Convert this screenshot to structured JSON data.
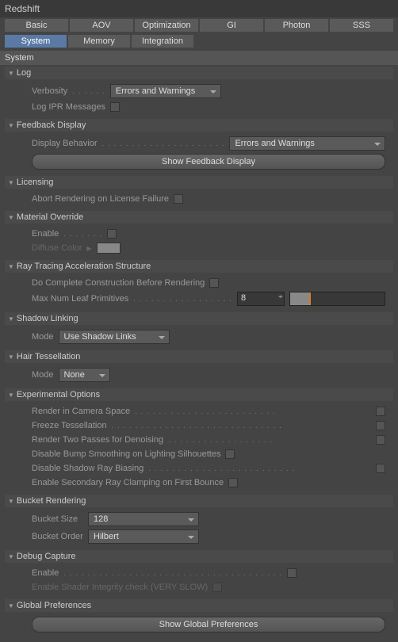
{
  "window": {
    "title": "Redshift"
  },
  "tabs": {
    "row1": [
      "Basic",
      "AOV",
      "Optimization",
      "GI",
      "Photon",
      "SSS"
    ],
    "row2": [
      "System",
      "Memory",
      "Integration"
    ],
    "active": "System"
  },
  "panel": {
    "title": "System"
  },
  "sections": {
    "log": {
      "title": "Log",
      "verbosity_label": "Verbosity",
      "verbosity_value": "Errors and Warnings",
      "log_ipr_label": "Log IPR Messages"
    },
    "feedback": {
      "title": "Feedback Display",
      "display_behavior_label": "Display Behavior",
      "display_behavior_value": "Errors and Warnings",
      "show_button": "Show Feedback Display"
    },
    "licensing": {
      "title": "Licensing",
      "abort_label": "Abort Rendering on License Failure"
    },
    "material": {
      "title": "Material Override",
      "enable_label": "Enable",
      "diffuse_label": "Diffuse Color"
    },
    "raytracing": {
      "title": "Ray Tracing Acceleration Structure",
      "complete_label": "Do Complete Construction Before Rendering",
      "maxleaf_label": "Max Num Leaf Primitives",
      "maxleaf_value": "8"
    },
    "shadow": {
      "title": "Shadow Linking",
      "mode_label": "Mode",
      "mode_value": "Use Shadow Links"
    },
    "hair": {
      "title": "Hair Tessellation",
      "mode_label": "Mode",
      "mode_value": "None"
    },
    "experimental": {
      "title": "Experimental Options",
      "camera_space": "Render in Camera Space",
      "freeze": "Freeze Tessellation",
      "two_passes": "Render Two Passes for Denoising",
      "bump_smooth": "Disable Bump Smoothing on Lighting Silhouettes",
      "shadow_bias": "Disable Shadow Ray Biasing",
      "secondary_clamp": "Enable Secondary Ray Clamping on First Bounce"
    },
    "bucket": {
      "title": "Bucket Rendering",
      "size_label": "Bucket Size",
      "size_value": "128",
      "order_label": "Bucket Order",
      "order_value": "Hilbert"
    },
    "debug": {
      "title": "Debug Capture",
      "enable_label": "Enable",
      "shader_label": "Enable Shader Integrity check (VERY SLOW)"
    },
    "global": {
      "title": "Global Preferences",
      "show_button": "Show Global Preferences"
    }
  }
}
